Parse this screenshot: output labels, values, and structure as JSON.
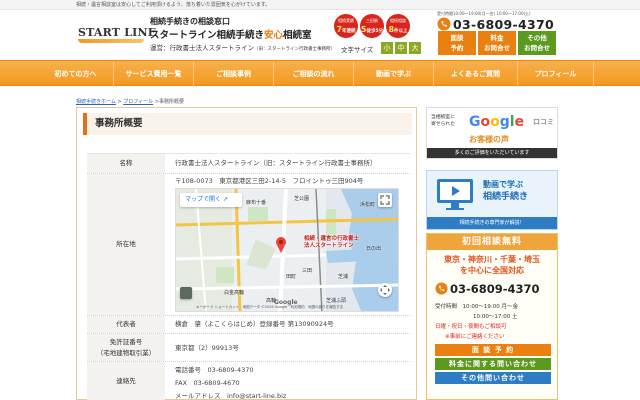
{
  "topbar": {
    "text": "相続・遺言相談室は安心してご利用頂けるよう、落ち着いた雰囲気を心がけています。"
  },
  "header": {
    "logo_text": "START LINE",
    "subtitle": "相続手続きの相談窓口",
    "title_pre": "スタートライン相続手続き",
    "title_accent": "安心",
    "title_post": "相続室",
    "operator": "運営：行政書士法人スタートライン",
    "operator_small": "（旧：スタートライン行政書士事務所）",
    "medals": [
      {
        "top": "相続実績",
        "num": "7",
        "bot": "年連続"
      },
      {
        "top": "三田駅",
        "num": "5",
        "bot": "徒歩5分"
      },
      {
        "top": "相続相談",
        "num": "8",
        "bot": "件以上"
      }
    ],
    "font_size_label": "文字サイズ",
    "font_sizes": [
      "小",
      "中",
      "大"
    ],
    "hours_small": "受付時間10:00～19:00(月～金) 10:00～17:00(土)",
    "tel": "03-6809-4370",
    "buttons": [
      {
        "l1": "面談",
        "l2": "予約"
      },
      {
        "l1": "料金",
        "l2": "お問合せ"
      },
      {
        "l1": "その他",
        "l2": "お問合せ"
      }
    ]
  },
  "nav": [
    "初めての方へ",
    "サービス費用一覧",
    "ご相談事例",
    "ご相談の流れ",
    "動画で学ぶ",
    "よくあるご質問",
    "プロフィール"
  ],
  "breadcrumb": {
    "home": "相続手続きホーム",
    "sep": ">",
    "profile": "プロフィール",
    "current": "事務所概要"
  },
  "section_title": "事務所概要",
  "table": [
    {
      "th": "名称",
      "td": [
        "行政書士法人スタートライン（旧：スタートライン行政書士事務所）"
      ]
    },
    {
      "th": "所在地",
      "td": [
        "〒108-0073　東京都港区三田2-14-5　フロイントゥ三田904号"
      ]
    },
    {
      "th": "代表者",
      "td": [
        "横倉　肇（よこくらはじめ）登録番号 第13090924号"
      ]
    },
    {
      "th1": "免許証番号",
      "th2": "（宅地建物取引業）",
      "td": [
        "東京都（2）99913号"
      ]
    },
    {
      "th": "連絡先",
      "td": [
        "電話番号　03-6809-4370",
        "FAX　03-6809-4670",
        "メールアドレス　info@start-line.biz"
      ]
    }
  ],
  "map": {
    "button": "マップで開く",
    "pin_label_1": "相続・遺言の行政書士",
    "pin_label_2": "法人スタートライン",
    "credit": "キーボード ショートカット　地図データ ©2026 Google　利用規約　地図の誤りを報告する",
    "google": "Google",
    "place_labels": [
      "麻布十番",
      "芝公園",
      "三田",
      "田町",
      "芝浦",
      "浜松町",
      "日の出",
      "白金高輪",
      "芝浦ふ頭",
      "高輪"
    ]
  },
  "sidebar": {
    "review_small_1": "当相続室に",
    "review_small_2": "寄せられた",
    "google": "Google",
    "kuchikomi": "口コミ",
    "voice": "お客様の声",
    "review_strip": "多くのご評価をいただいています",
    "video_1": "動画で学ぶ",
    "video_2": "相続手続き",
    "video_strip": "相続手続きの専門家が解説！",
    "free_consult": "初回相談無料",
    "areas_1": "東京・神奈川・千葉・埼玉",
    "areas_2": "を中心に全国対応",
    "tel": "03-6809-4370",
    "hours_label": "受付時間",
    "hours_1": "10:00～19:00 月～金",
    "hours_2": "10:00～17:00 土",
    "note_1": "日曜・祝日・夜間もご相談可",
    "note_2": "※事前にご連絡ください",
    "btn_1": "面 談 予 約",
    "btn_2": "料金に関する問い合わせ",
    "btn_3": "その他問い合わせ"
  },
  "colors": {
    "accent_orange": "#f29a22",
    "accent_green": "#5b9a1f",
    "accent_blue": "#2d7cc4",
    "red": "#d8261d"
  }
}
